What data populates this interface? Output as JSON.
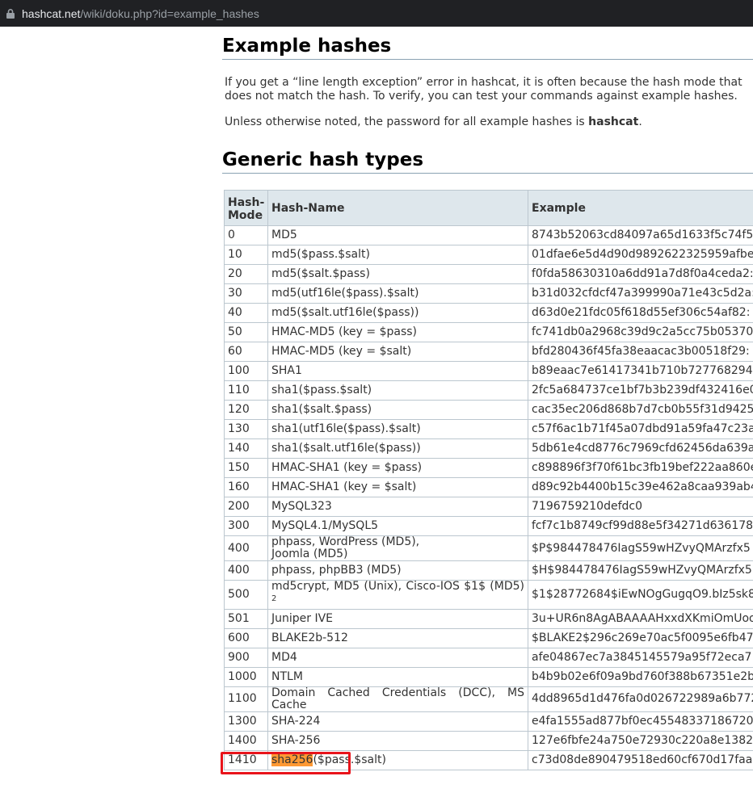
{
  "browser": {
    "url_host": "hashcat.net",
    "url_path": "/wiki/doku.php?id=example_hashes"
  },
  "page": {
    "title": "Example hashes",
    "intro": "If you get a “line length exception” error in hashcat, it is often because the hash mode that",
    "intro2": "does not match the hash. To verify, you can test your commands against example hashes.",
    "password_note_prefix": "Unless otherwise noted, the password for all example hashes is ",
    "password_note_bold": "hashcat",
    "password_note_suffix": ".",
    "section_title": "Generic hash types"
  },
  "table": {
    "headers": {
      "mode": "Hash-Mode",
      "name": "Hash-Name",
      "example": "Example"
    },
    "rows": [
      {
        "mode": "0",
        "name": "MD5",
        "example": "8743b52063cd84097a65d1633f5c74f5"
      },
      {
        "mode": "10",
        "name": "md5($pass.$salt)",
        "example": "01dfae6e5d4d90d9892622325959afbe"
      },
      {
        "mode": "20",
        "name": "md5($salt.$pass)",
        "example": "f0fda58630310a6dd91a7d8f0a4ceda2:"
      },
      {
        "mode": "30",
        "name": "md5(utf16le($pass).$salt)",
        "example": "b31d032cfdcf47a399990a71e43c5d2a:"
      },
      {
        "mode": "40",
        "name": "md5($salt.utf16le($pass))",
        "example": "d63d0e21fdc05f618d55ef306c54af82:"
      },
      {
        "mode": "50",
        "name": "HMAC-MD5 (key = $pass)",
        "example": "fc741db0a2968c39d9c2a5cc75b05370"
      },
      {
        "mode": "60",
        "name": "HMAC-MD5 (key = $salt)",
        "example": "bfd280436f45fa38eaacac3b00518f29:"
      },
      {
        "mode": "100",
        "name": "SHA1",
        "example": "b89eaac7e61417341b710b727768294"
      },
      {
        "mode": "110",
        "name": "sha1($pass.$salt)",
        "example": "2fc5a684737ce1bf7b3b239df432416e0"
      },
      {
        "mode": "120",
        "name": "sha1($salt.$pass)",
        "example": "cac35ec206d868b7d7cb0b55f31d9425"
      },
      {
        "mode": "130",
        "name": "sha1(utf16le($pass).$salt)",
        "example": "c57f6ac1b71f45a07dbd91a59fa47c23a"
      },
      {
        "mode": "140",
        "name": "sha1($salt.utf16le($pass))",
        "example": "5db61e4cd8776c7969cfd62456da639a"
      },
      {
        "mode": "150",
        "name": "HMAC-SHA1 (key = $pass)",
        "example": "c898896f3f70f61bc3fb19bef222aa860e"
      },
      {
        "mode": "160",
        "name": "HMAC-SHA1 (key = $salt)",
        "example": "d89c92b4400b15c39e462a8caa939ab4"
      },
      {
        "mode": "200",
        "name": "MySQL323",
        "example": "7196759210defdc0"
      },
      {
        "mode": "300",
        "name": "MySQL4.1/MySQL5",
        "example": "fcf7c1b8749cf99d88e5f34271d636178"
      },
      {
        "mode": "400",
        "name": "phpass, WordPress (MD5), Joomla (MD5)",
        "example": "$P$984478476IagS59wHZvyQMArzfx5"
      },
      {
        "mode": "400",
        "name": "phpass, phpBB3 (MD5)",
        "example": "$H$984478476IagS59wHZvyQMArzfx5"
      },
      {
        "mode": "500",
        "name": "md5crypt, MD5 (Unix), Cisco-IOS $1$ (MD5)",
        "footnote": "2",
        "example": "$1$28772684$iEwNOgGugqO9.bIz5sk8"
      },
      {
        "mode": "501",
        "name": "Juniper IVE",
        "example": "3u+UR6n8AgABAAAAHxxdXKmiOmUoo"
      },
      {
        "mode": "600",
        "name": "BLAKE2b-512",
        "example": "$BLAKE2$296c269e70ac5f0095e6fb47"
      },
      {
        "mode": "900",
        "name": "MD4",
        "example": "afe04867ec7a3845145579a95f72eca7"
      },
      {
        "mode": "1000",
        "name": "NTLM",
        "example": "b4b9b02e6f09a9bd760f388b67351e2b"
      },
      {
        "mode": "1100",
        "name": "Domain Cached Credentials (DCC), MS Cache",
        "example": "4dd8965d1d476fa0d026722989a6b772"
      },
      {
        "mode": "1300",
        "name": "SHA-224",
        "example": "e4fa1555ad877bf0ec455483371867200"
      },
      {
        "mode": "1400",
        "name": "SHA-256",
        "example": "127e6fbfe24a750e72930c220a8e1382"
      },
      {
        "mode": "1410",
        "name_highlight": "sha256",
        "name_rest": "($pass.$salt)",
        "example": "c73d08de890479518ed60cf670d17faa"
      }
    ]
  },
  "colors": {
    "highlight": "#ff9933",
    "annotation_box": "#e8141b",
    "table_header_bg": "#dee7ec"
  }
}
